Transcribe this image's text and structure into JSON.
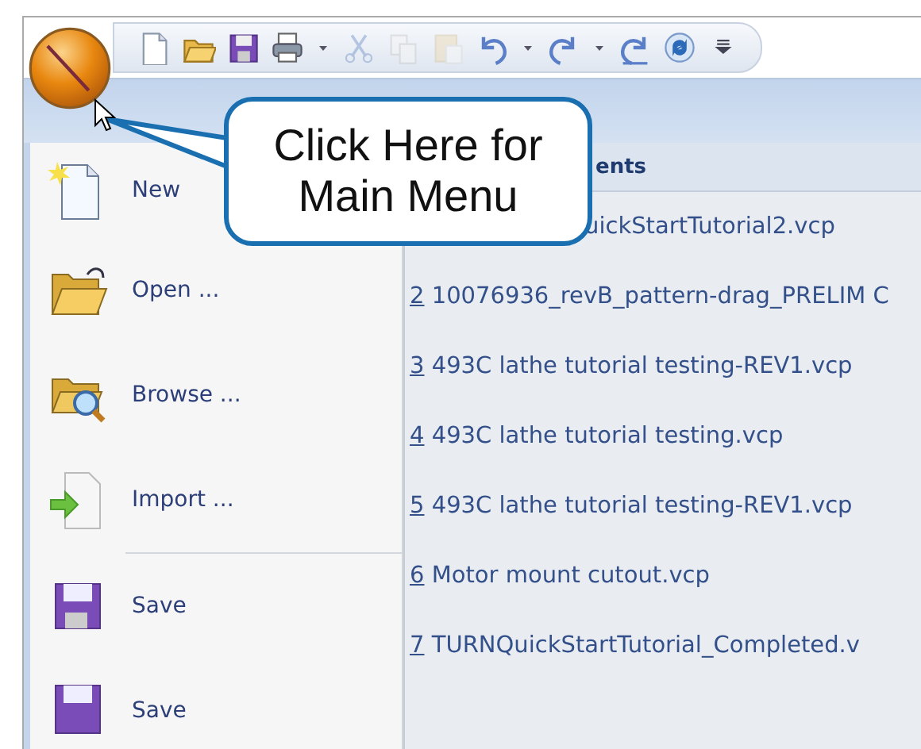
{
  "toolbar": {
    "items": [
      {
        "kind": "new",
        "disabled": false
      },
      {
        "kind": "open",
        "disabled": false
      },
      {
        "kind": "save",
        "disabled": false
      },
      {
        "kind": "print",
        "disabled": false
      },
      {
        "kind": "dropdown",
        "disabled": false
      },
      {
        "kind": "cut",
        "disabled": true
      },
      {
        "kind": "copy",
        "disabled": true
      },
      {
        "kind": "paste",
        "disabled": true
      },
      {
        "kind": "undo",
        "disabled": false
      },
      {
        "kind": "dropdown",
        "disabled": false
      },
      {
        "kind": "redo",
        "disabled": false
      },
      {
        "kind": "dropdown",
        "disabled": false
      },
      {
        "kind": "redo-all",
        "disabled": false
      },
      {
        "kind": "refresh",
        "disabled": false
      },
      {
        "kind": "customize",
        "disabled": false
      }
    ]
  },
  "main_menu": {
    "items": [
      {
        "kind": "new",
        "label": "New"
      },
      {
        "kind": "open",
        "label": "Open ..."
      },
      {
        "kind": "browse",
        "label": "Browse ..."
      },
      {
        "kind": "import",
        "label": "Import ..."
      },
      {
        "kind": "separator"
      },
      {
        "kind": "save",
        "label": "Save"
      },
      {
        "kind": "save-as",
        "label": "Save"
      }
    ]
  },
  "recent": {
    "header": "ents",
    "items": [
      {
        "name": "uickStartTutorial2.vcp"
      },
      {
        "number": "2",
        "name": "10076936_revB_pattern-drag_PRELIM C"
      },
      {
        "number": "3",
        "name": "493C lathe tutorial testing-REV1.vcp"
      },
      {
        "number": "4",
        "name": "493C lathe tutorial testing.vcp"
      },
      {
        "number": "5",
        "name": "493C lathe tutorial testing-REV1.vcp"
      },
      {
        "number": "6",
        "name": "Motor mount cutout.vcp"
      },
      {
        "number": "7",
        "name": "TURNQuickStartTutorial_Completed.v"
      }
    ]
  },
  "callout": {
    "lines": [
      "Click Here for",
      "Main Menu"
    ]
  }
}
